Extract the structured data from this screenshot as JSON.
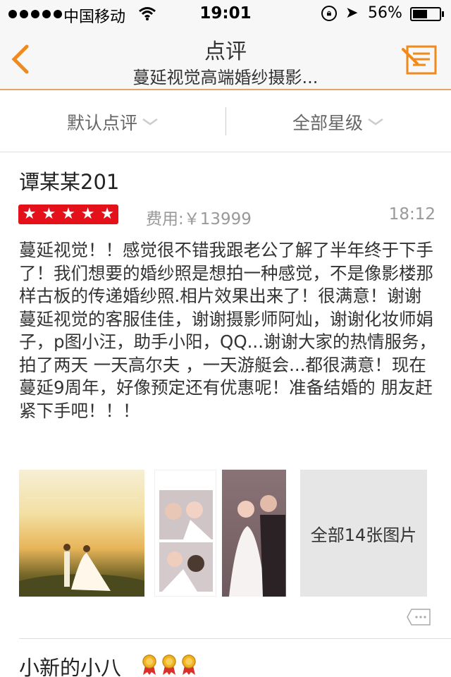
{
  "status_bar": {
    "carrier": "中国移动",
    "time": "19:01",
    "battery": "56%",
    "battery_level": 0.56
  },
  "nav": {
    "title": "点评",
    "subtitle": "蔓延视觉高端婚纱摄影..."
  },
  "filters": {
    "sort_label": "默认点评",
    "stars_label": "全部星级"
  },
  "review": {
    "username": "谭某某201",
    "rating": 5,
    "fee": "费用:￥13999",
    "time": "18:12",
    "text": "蔓延视觉！！感觉很不错我跟老公了解了半年终于下手了！我们想要的婚纱照是想拍一种感觉，不是像影楼那样古板的传递婚纱照.相片效果出来了！很满意！谢谢蔓延视觉的客服佳佳，谢谢摄影师阿灿，谢谢化妆师娟子，p图小汪，助手小阳，QQ...谢谢大家的热情服务，拍了两天 一天高尔夫 ，一天游艇会...都很满意！现在蔓延9周年，好像预定还有优惠呢！准备结婚的 朋友赶紧下手吧！！！",
    "all_photos_label": "全部14张图片"
  },
  "next_review": {
    "username": "小新的小八",
    "medals": 3
  },
  "colors": {
    "accent": "#f08a1c",
    "star_bg": "#e4101a"
  }
}
